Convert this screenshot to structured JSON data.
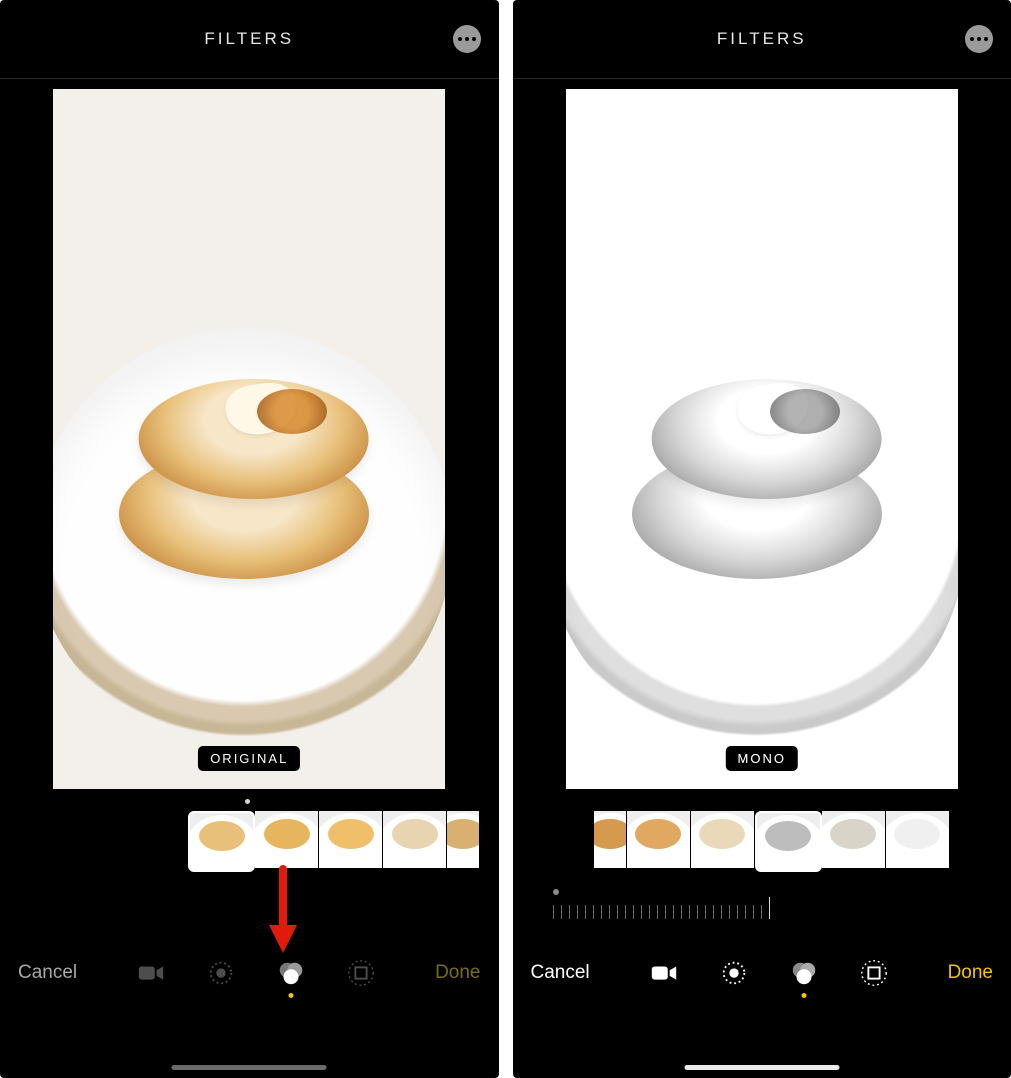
{
  "left": {
    "header_title": "FILTERS",
    "filter_badge": "ORIGINAL",
    "cancel_label": "Cancel",
    "done_label": "Done",
    "cancel_active": false,
    "done_active": false,
    "thumbs": [
      {
        "id": "original",
        "selected": true,
        "tint": "#e8c07a"
      },
      {
        "id": "vivid",
        "selected": false,
        "tint": "#e8b55f"
      },
      {
        "id": "vivid-warm",
        "selected": false,
        "tint": "#efbf6a"
      },
      {
        "id": "vivid-cool",
        "selected": false,
        "tint": "#e9d4b2"
      },
      {
        "id": "dramatic",
        "selected": false,
        "tint": "#d8b070",
        "partial": true
      }
    ],
    "annotation_arrow": true
  },
  "right": {
    "header_title": "FILTERS",
    "filter_badge": "MONO",
    "cancel_label": "Cancel",
    "done_label": "Done",
    "cancel_active": true,
    "done_active": true,
    "thumbs": [
      {
        "id": "dramatic",
        "selected": false,
        "tint": "#d69a4f",
        "partial": true
      },
      {
        "id": "dramatic-warm",
        "selected": false,
        "tint": "#e0a860"
      },
      {
        "id": "dramatic-cool",
        "selected": false,
        "tint": "#ead9b8"
      },
      {
        "id": "mono",
        "selected": true,
        "tint": "#bdbdbd"
      },
      {
        "id": "silvertone",
        "selected": false,
        "tint": "#d8d4c8"
      },
      {
        "id": "noir",
        "selected": false,
        "tint": "#f0f0f0"
      }
    ],
    "slider_ticks": 28,
    "annotation_arrow": false
  },
  "colors": {
    "accent": "#f6c500",
    "arrow": "#e11b0c"
  }
}
